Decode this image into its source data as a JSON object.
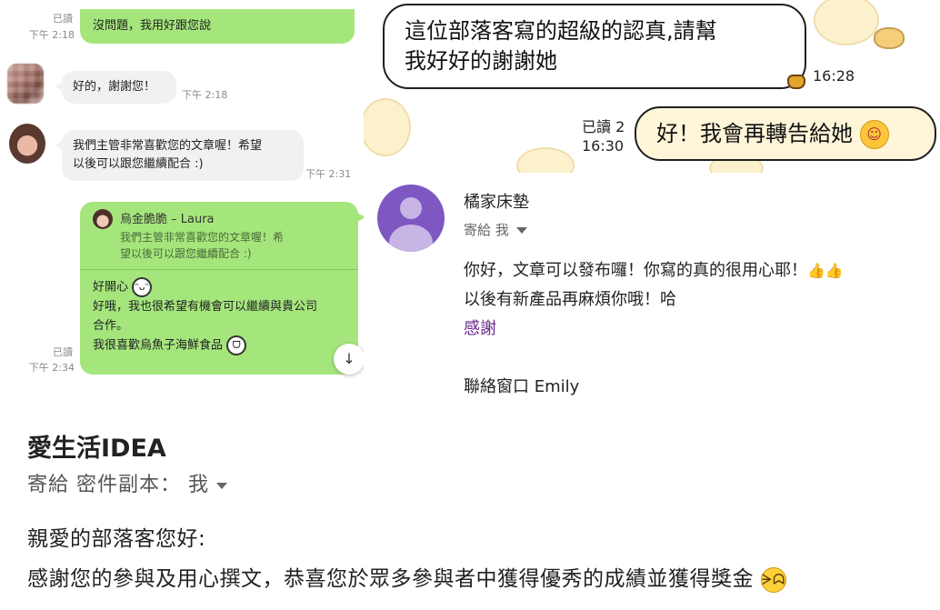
{
  "line_chat": {
    "msg1": {
      "read": "已讀",
      "time": "下午 2:18",
      "text": "沒問題，我用好跟您說"
    },
    "msg2": {
      "text": "好的，謝謝您！",
      "time": "下午 2:18"
    },
    "msg3": {
      "text_line1": "我們主管非常喜歡您的文章喔！希望",
      "text_line2": "以後可以跟您繼續配合 :)",
      "time": "下午 2:31"
    },
    "msg4": {
      "read": "已讀",
      "time": "下午 2:34",
      "quote_name": "烏金脆脆 – Laura",
      "quote_line1": "我們主管非常喜歡您的文章喔！希",
      "quote_line2": "望以後可以跟您繼續配合 :)",
      "line1": "好開心",
      "line2": "好哦，我也很希望有機會可以繼續與貴公司",
      "line3": "合作。",
      "line4": "我很喜歡烏魚子海鮮食品"
    },
    "scroll_down_icon": "↓"
  },
  "sticker_chat": {
    "incoming_line1": "這位部落客寫的超級的認真,請幫",
    "incoming_line2": "我好好的謝謝她",
    "incoming_time": "16:28",
    "read_label": "已讀 2",
    "outgoing_time": "16:30",
    "outgoing_text": "好！我會再轉告給她",
    "blush_emoji": "☺"
  },
  "email1": {
    "sender": "橘家床墊",
    "to_label": "寄給 我",
    "line1": "你好，文章可以發布囉！你寫的真的很用心耶！",
    "thumbs": "👍👍",
    "line2": "以後有新產品再麻煩你哦！哈",
    "line3": "感謝",
    "line4": "聯絡窗口 Emily",
    "avatar_color": "#7e57c2"
  },
  "email2": {
    "sender": "愛生活IDEA",
    "to_label": "寄給 密件副本： 我",
    "greeting": "親愛的部落客您好:",
    "body": "感謝您的參與及用心撰文，恭喜您於眾多參與者中獲得優秀的成績並獲得獎金",
    "grin_emoji": "≧▽≦"
  },
  "colors": {
    "line_green": "#a5e67c",
    "line_gray": "#f1f1f1",
    "link_purple": "#6a2a8a"
  }
}
